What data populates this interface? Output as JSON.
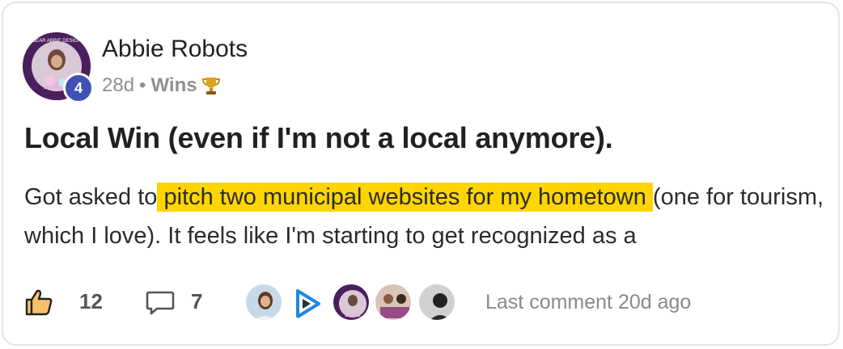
{
  "post": {
    "author_name": "Abbie Robots",
    "author_level": "4",
    "age": "28d",
    "separator": "•",
    "category": "Wins",
    "title": "Local Win (even if I'm not a local anymore).",
    "body_before": "Got asked to",
    "body_highlight": " pitch two municipal websites for my hometown ",
    "body_after": "(one for tourism, which I love). It feels like I'm starting to get recognized as a",
    "avatar_ring_text": "DEAR ABBIE DESIGN"
  },
  "footer": {
    "likes": "12",
    "comments": "7",
    "last_comment": "Last comment 20d ago",
    "participants": [
      "participant-1",
      "participant-2",
      "participant-3",
      "participant-4",
      "participant-5"
    ]
  },
  "colors": {
    "highlight": "#ffd500",
    "level_badge": "#3f51b5",
    "text": "#202124",
    "muted": "#909090"
  }
}
